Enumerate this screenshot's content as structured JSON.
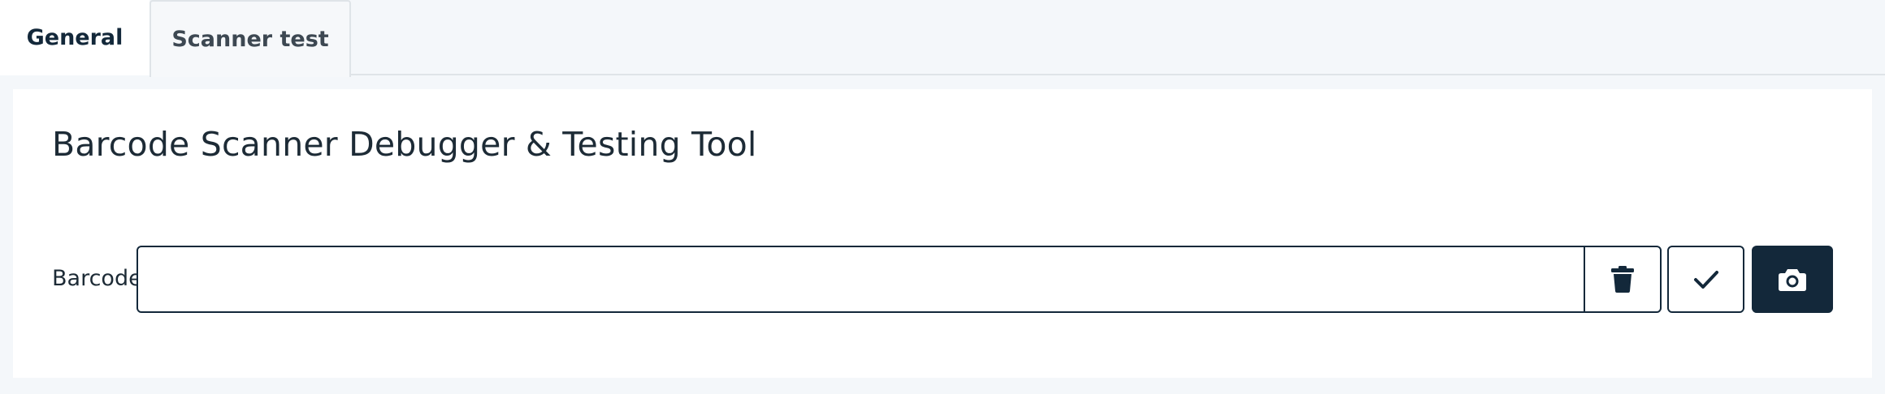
{
  "tabs": [
    {
      "label": "General",
      "active": true
    },
    {
      "label": "Scanner test",
      "active": false
    }
  ],
  "page": {
    "title": "Barcode Scanner Debugger & Testing Tool"
  },
  "barcode": {
    "label": "Barcode",
    "value": "",
    "placeholder": ""
  },
  "buttons": {
    "delete_icon": "trash-icon",
    "confirm_icon": "check-icon",
    "camera_icon": "camera-icon"
  },
  "colors": {
    "primary": "#13283a",
    "background": "#f4f7fa",
    "card": "#ffffff",
    "border": "#dfe4e8"
  }
}
